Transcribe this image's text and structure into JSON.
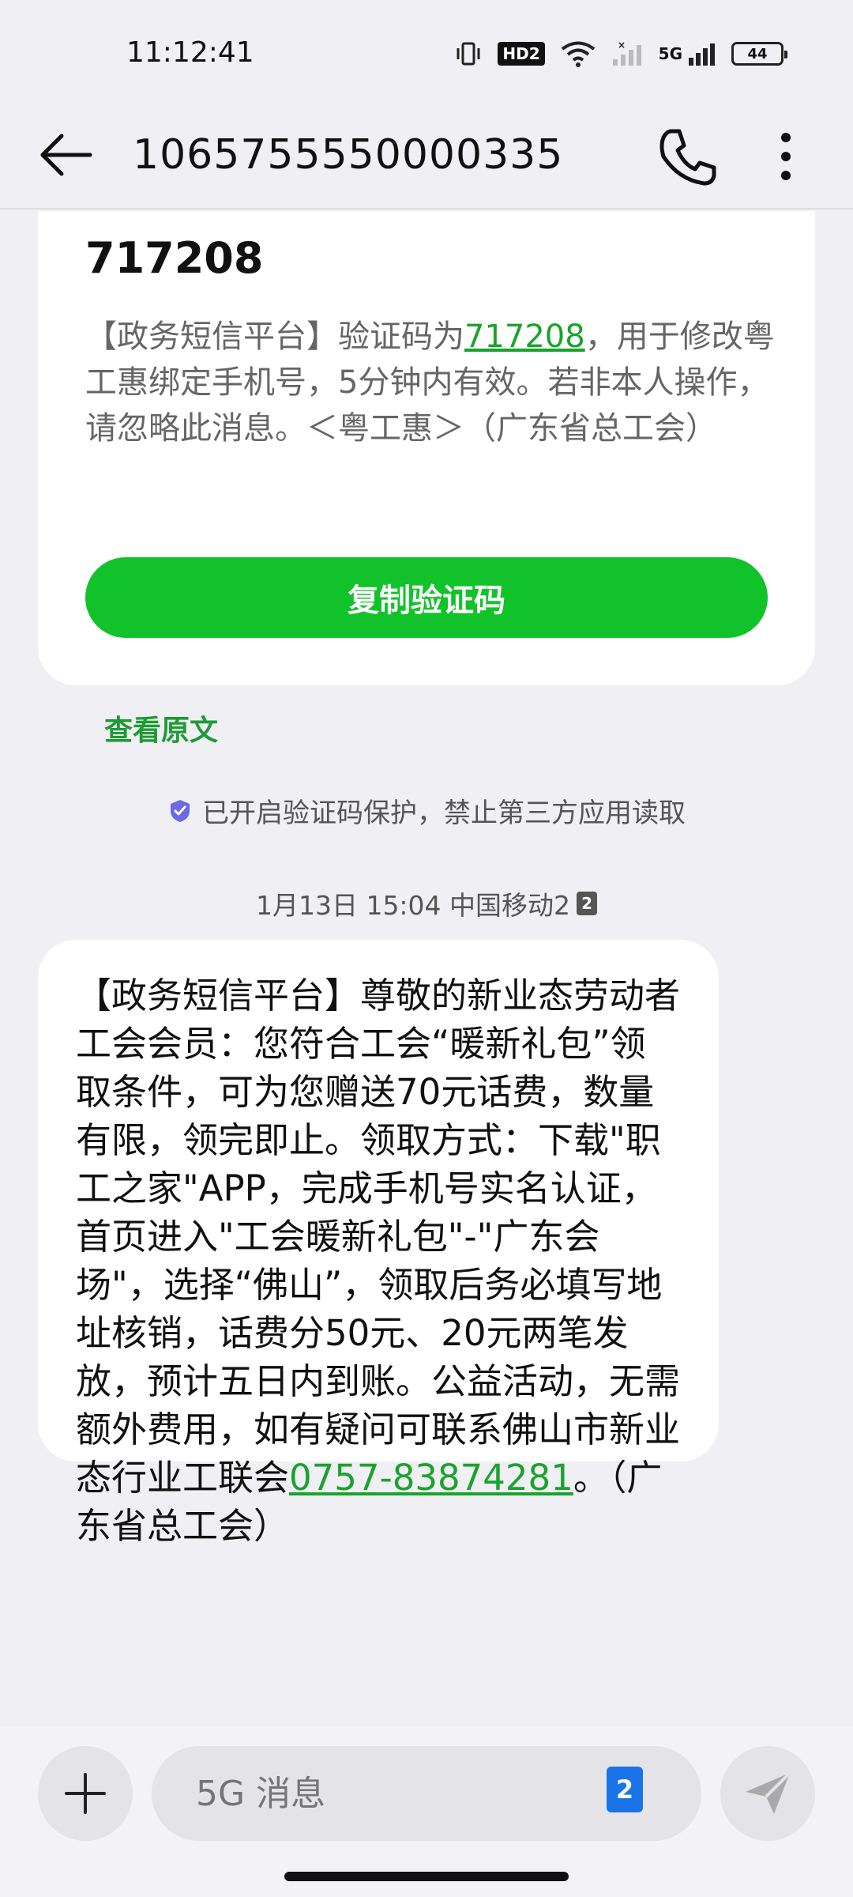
{
  "status_bar": {
    "time": "11:12:41",
    "hd_label": "HD2",
    "network_label": "5G",
    "battery": "44"
  },
  "header": {
    "title": "1065755550000335"
  },
  "otp_card": {
    "code": "717208",
    "text_before": "【政务短信平台】验证码为",
    "link": "717208",
    "text_after": "，用于修改粤工惠绑定手机号，5分钟内有效。若非本人操作，请忽略此消息。＜粤工惠＞（广东省总工会）",
    "copy_button": "复制验证码"
  },
  "view_original": "查看原文",
  "protection_notice": "已开启验证码保护，禁止第三方应用读取",
  "timestamp": {
    "text": "1月13日 15:04 中国移动2",
    "sim": "2"
  },
  "message": {
    "text_before": "【政务短信平台】尊敬的新业态劳动者工会会员：您符合工会“暖新礼包”领取条件，可为您赠送70元话费，数量有限，领完即止。领取方式：下载\"职工之家\"APP，完成手机号实名认证，首页进入\"工会暖新礼包\"-\"广东会场\"，选择“佛山”，领取后务必填写地址核销，话费分50元、20元两笔发放，预计五日内到账。公益活动，无需额外费用，如有疑问可联系佛山市新业态行业工联会",
    "phone": "0757-83874281",
    "text_after": "。（广东省总工会）"
  },
  "input_bar": {
    "placeholder": "5G 消息",
    "sim": "2"
  },
  "colors": {
    "accent_green": "#12c22a",
    "link_green": "#1aa32c",
    "sim_blue": "#1a73e8"
  }
}
